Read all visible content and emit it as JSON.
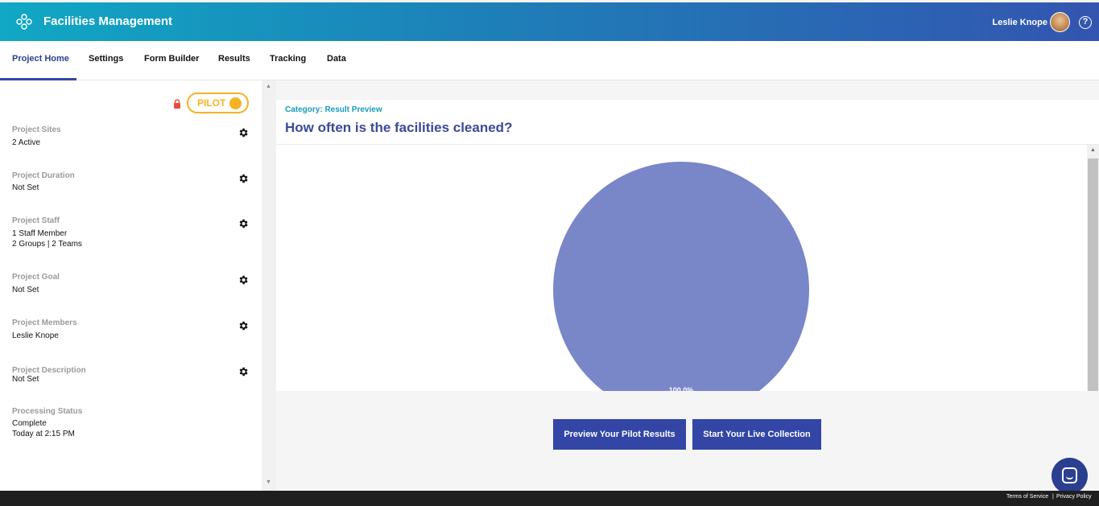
{
  "header": {
    "app_title": "Facilities Management",
    "user_name": "Leslie Knope",
    "help_glyph": "?"
  },
  "nav": {
    "tabs": [
      "Project Home",
      "Settings",
      "Form Builder",
      "Results",
      "Tracking",
      "Data"
    ],
    "active_tab": "Project Home"
  },
  "sidebar": {
    "pilot_label": "PILOT",
    "items": [
      {
        "label": "Project Sites",
        "value": "2 Active",
        "value2": ""
      },
      {
        "label": "Project Duration",
        "value": "Not Set",
        "value2": ""
      },
      {
        "label": "Project Staff",
        "value": "1 Staff Member",
        "value2": "2 Groups | 2 Teams"
      },
      {
        "label": "Project Goal",
        "value": "Not Set",
        "value2": ""
      },
      {
        "label": "Project Members",
        "value": "Leslie Knope",
        "value2": ""
      },
      {
        "label": "Project Description",
        "value": "Not Set",
        "value2": ""
      }
    ],
    "processing": {
      "label": "Processing Status",
      "value": "Complete",
      "value2": "Today at 2:15 PM"
    }
  },
  "main": {
    "category": "Category: Result Preview",
    "question": "How often is the facilities cleaned?",
    "preview_button": "Preview Your Pilot Results",
    "live_button": "Start Your Live Collection"
  },
  "chart_data": {
    "type": "pie",
    "categories": [
      ""
    ],
    "values": [
      100
    ],
    "data_labels": [
      "100.0%"
    ],
    "colors": [
      "#7986c8"
    ]
  },
  "footer": {
    "terms": "Terms of Service",
    "separator": "|",
    "privacy": "Privacy Policy"
  },
  "colors": {
    "header_gradient_start": "#10a8c4",
    "header_gradient_end": "#3355b0",
    "primary": "#3346a6",
    "pilot": "#f5b324",
    "pie_slice": "#7986c8"
  },
  "icons": {
    "logo": "molecule-logo-icon",
    "help": "help-circle-icon",
    "lock": "lock-icon",
    "gear": "gear-icon",
    "chat": "chat-bubble-icon"
  }
}
